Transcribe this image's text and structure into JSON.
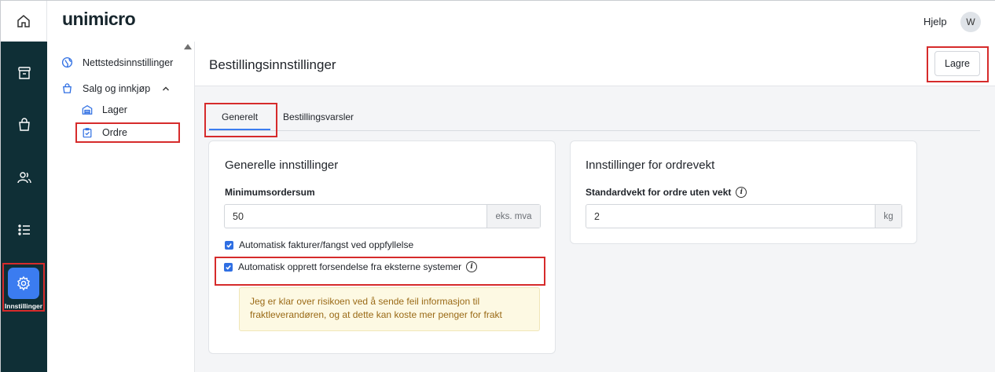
{
  "app": {
    "logo": "unimicro",
    "help": "Hjelp",
    "avatar": "W"
  },
  "rail": {
    "items": [
      {
        "icon": "home-icon"
      },
      {
        "icon": "archive-box-icon"
      },
      {
        "icon": "shopping-bag-icon"
      },
      {
        "icon": "users-icon"
      },
      {
        "icon": "list-icon"
      },
      {
        "icon": "gear-icon",
        "label": "Innstillinger",
        "active": true
      }
    ]
  },
  "sidebar": {
    "items": [
      {
        "label": "Nettstedsinnstillinger",
        "icon": "globe-icon"
      },
      {
        "label": "Salg og innkjøp",
        "icon": "shopping-bag-icon",
        "expanded": true
      },
      {
        "label": "Lager",
        "icon": "warehouse-icon"
      },
      {
        "label": "Ordre",
        "icon": "clipboard-check-icon",
        "selected": true
      }
    ]
  },
  "page": {
    "title": "Bestillingsinnstillinger",
    "save_label": "Lagre",
    "tabs": [
      {
        "label": "Generelt",
        "active": true
      },
      {
        "label": "Bestillingsvarsler",
        "active": false
      }
    ]
  },
  "general": {
    "title": "Generelle innstillinger",
    "min_label": "Minimumsordersum",
    "min_value": "50",
    "min_suffix": "eks. mva",
    "check1": "Automatisk fakturer/fangst ved oppfyllelse",
    "check2": "Automatisk opprett forsendelse fra eksterne systemer",
    "warning": "Jeg er klar over risikoen ved å sende feil informasjon til fraktleverandøren, og at dette kan koste mer penger for frakt"
  },
  "weight": {
    "title": "Innstillinger for ordrevekt",
    "label": "Standardvekt for ordre uten vekt",
    "value": "2",
    "suffix": "kg"
  },
  "colors": {
    "rail": "#0f2f36",
    "accent": "#3b7cf0",
    "highlight": "#d62b2b",
    "warning_bg": "#fdf9e3"
  }
}
